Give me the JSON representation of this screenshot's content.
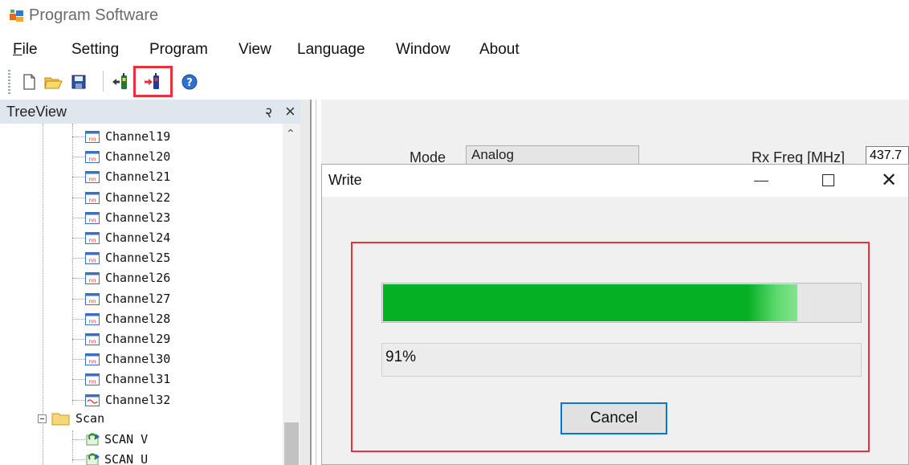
{
  "app": {
    "title": "Program Software"
  },
  "menu": {
    "items": [
      "File",
      "Setting",
      "Program",
      "View",
      "Language",
      "Window",
      "About"
    ]
  },
  "toolbar": {
    "buttons": [
      "new-file-icon",
      "open-folder-icon",
      "save-icon",
      "read-from-radio-icon",
      "write-to-radio-icon",
      "help-icon"
    ]
  },
  "treeview": {
    "title": "TreeView",
    "pin": "२",
    "close": "×",
    "channels": [
      "Channel19",
      "Channel20",
      "Channel21",
      "Channel22",
      "Channel23",
      "Channel24",
      "Channel25",
      "Channel26",
      "Channel27",
      "Channel28",
      "Channel29",
      "Channel30",
      "Channel31",
      "Channel32"
    ],
    "scan_folder": "Scan",
    "scan_items": [
      "SCAN V",
      "SCAN U"
    ]
  },
  "background_form": {
    "mode_label": "Mode",
    "mode_value": "Analog",
    "rx_label": "Rx Freq [MHz]",
    "rx_value": "437.7"
  },
  "dialog": {
    "title": "Write",
    "progress_percent": 91,
    "progress_text": "91%",
    "cancel_label": "Cancel"
  },
  "colors": {
    "highlight_border": "#e8313b",
    "progress_green": "#06b025",
    "focus_blue": "#0078d7"
  }
}
